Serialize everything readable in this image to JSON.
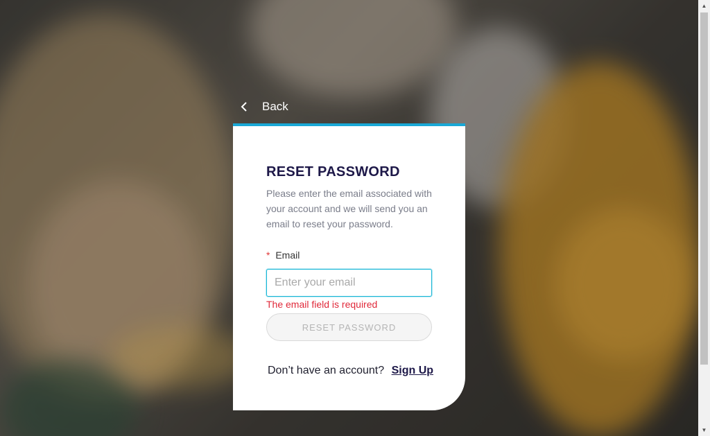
{
  "back": {
    "label": "Back",
    "icon": "chevron-left-icon"
  },
  "card": {
    "title": "RESET PASSWORD",
    "description": "Please enter the email associated with your account and we will send you an email to reset your password.",
    "accent_color": "#19a8d6",
    "email_field": {
      "required_mark": "*",
      "label": "Email",
      "placeholder": "Enter your email",
      "value": "",
      "error": "The email field is required"
    },
    "submit_label": "RESET PASSWORD",
    "signup": {
      "prompt": "Don’t have an account?",
      "link_label": "Sign Up"
    }
  },
  "scrollbar": {
    "up_icon": "arrow-up-icon",
    "down_icon": "arrow-down-icon"
  }
}
